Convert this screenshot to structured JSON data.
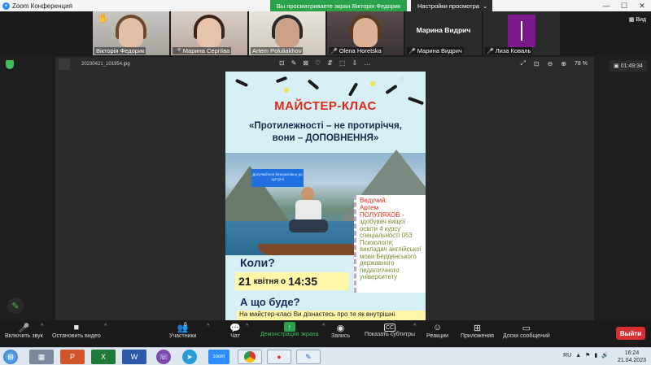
{
  "titlebar": {
    "title": "Zoom Конференция"
  },
  "share_banner": {
    "text": "Вы просматриваете экран Вікторія Федорик"
  },
  "view_settings": {
    "label": "Настройки просмотра",
    "arrow": "⌄"
  },
  "window_controls": {
    "minimize": "—",
    "maximize": "☐",
    "close": "✕"
  },
  "participants": [
    {
      "name": "Вікторія Федорик",
      "hand": "✋"
    },
    {
      "name": "Марина Сергіїва"
    },
    {
      "name": "Artem Poluliakhov"
    },
    {
      "name": "Olena Horetska"
    },
    {
      "name": "Марина Видрич",
      "display": "Марина Видрич"
    },
    {
      "name": "Лиза Коваль"
    }
  ],
  "gallery_video_label": "Вид",
  "viewer": {
    "filename": "20230421_101954.jpg",
    "tools": [
      "⊡",
      "✎",
      "⊠",
      "♡",
      "⇵",
      "⬚",
      "⇩",
      "…"
    ],
    "zoom": "78 %",
    "expand": "⤢",
    "fit": "⊡",
    "zoom_out": "⊖",
    "zoom_in": "⊕"
  },
  "timer": {
    "value": "01:49:34"
  },
  "poster": {
    "title": "МАЙСТЕР-КЛАС",
    "subtitle_line1": "«Протилежності – не протиріччя,",
    "subtitle_line2": "вони – ДОПОВНЕННЯ»",
    "badge": "Долучайтеся безкоштовно до зустрічі",
    "host_label1": "Ведучий:",
    "host_label2": "Артем",
    "host_label3": "ПОЛУЛЯХОВ -",
    "host_desc": "здобувач вищої освіти 4 курсу спеціальності 053 Психологія; викладач англійської мови Бердянського державного педагогічного університету",
    "when": "Коли?",
    "date_day": "21",
    "date_text": "квітня о",
    "date_time": "14:35",
    "what": "А що буде?",
    "what_desc": "На майстер-класі Ви дізнаєтесь про те як внутрішні"
  },
  "toolbar": {
    "mute": "Включить звук",
    "video": "Остановить видео",
    "participants": "Участники",
    "participants_count": "6",
    "chat": "Чат",
    "share": "Демонстрация экрана",
    "record": "Запись",
    "subtitles": "Показать субтитры",
    "subtitles_icon": "CC",
    "reactions": "Реакции",
    "apps": "Приложения",
    "whiteboard": "Доски сообщений",
    "leave": "Выйти"
  },
  "taskbar": {
    "lang": "RU",
    "time": "16:24",
    "date": "21.04.2023",
    "zoom_label": "zoom",
    "apps": [
      "calc-icon",
      "presentation-icon",
      "excel-icon",
      "word-icon",
      "viber-icon",
      "telegram-icon",
      "zoom-icon",
      "chrome-icon",
      "yandex-icon",
      "paint-icon"
    ]
  },
  "colors": {
    "accent_green": "#2aa24a",
    "leave_red": "#d83030",
    "poster_title": "#e02a18"
  }
}
